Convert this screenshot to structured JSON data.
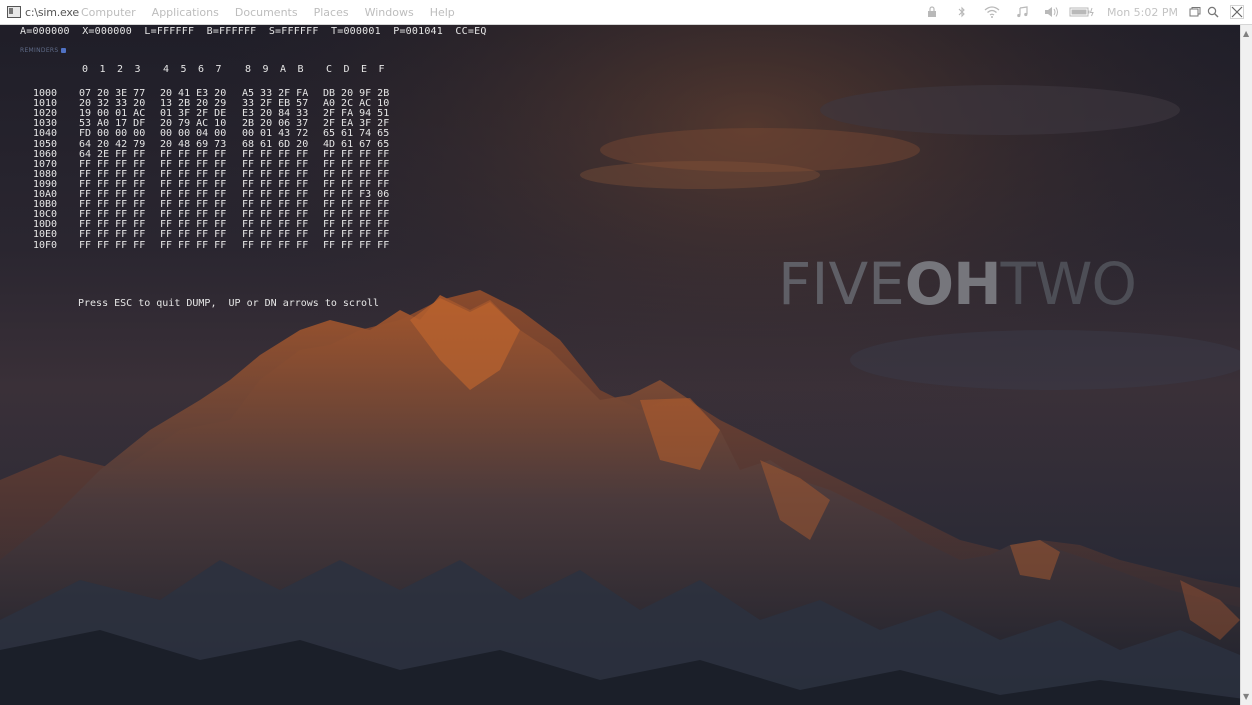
{
  "window": {
    "title": "c:\\sim.exe",
    "app_icon": "console-window-icon"
  },
  "menubar": {
    "items": [
      "Computer",
      "Applications",
      "Documents",
      "Places",
      "Windows",
      "Help"
    ],
    "clock": "Mon 5:02 PM",
    "tray_icons": [
      "lock-icon",
      "bluetooth-icon",
      "wifi-icon",
      "music-icon",
      "volume-icon",
      "battery-icon"
    ],
    "window_buttons": [
      "restore-icon",
      "search-icon",
      "close-icon"
    ]
  },
  "registers": "A=000000  X=000000  L=FFFFFF  B=FFFFFF  S=FFFFFF  T=000001  P=001041  CC=EQ",
  "reminders_label": "REMINDERS",
  "dump": {
    "header": [
      "0",
      "1",
      "2",
      "3",
      "4",
      "5",
      "6",
      "7",
      "8",
      "9",
      "A",
      "B",
      "C",
      "D",
      "E",
      "F"
    ],
    "rows": [
      {
        "addr": "1000",
        "bytes": [
          "07",
          "20",
          "3E",
          "77",
          "20",
          "41",
          "E3",
          "20",
          "A5",
          "33",
          "2F",
          "FA",
          "DB",
          "20",
          "9F",
          "2B"
        ]
      },
      {
        "addr": "1010",
        "bytes": [
          "20",
          "32",
          "33",
          "20",
          "13",
          "2B",
          "20",
          "29",
          "33",
          "2F",
          "EB",
          "57",
          "A0",
          "2C",
          "AC",
          "10"
        ]
      },
      {
        "addr": "1020",
        "bytes": [
          "19",
          "00",
          "01",
          "AC",
          "01",
          "3F",
          "2F",
          "DE",
          "E3",
          "20",
          "84",
          "33",
          "2F",
          "FA",
          "94",
          "51"
        ]
      },
      {
        "addr": "1030",
        "bytes": [
          "53",
          "A0",
          "17",
          "DF",
          "20",
          "79",
          "AC",
          "10",
          "2B",
          "20",
          "06",
          "37",
          "2F",
          "EA",
          "3F",
          "2F"
        ]
      },
      {
        "addr": "1040",
        "bytes": [
          "FD",
          "00",
          "00",
          "00",
          "00",
          "00",
          "04",
          "00",
          "00",
          "01",
          "43",
          "72",
          "65",
          "61",
          "74",
          "65"
        ]
      },
      {
        "addr": "1050",
        "bytes": [
          "64",
          "20",
          "42",
          "79",
          "20",
          "48",
          "69",
          "73",
          "68",
          "61",
          "6D",
          "20",
          "4D",
          "61",
          "67",
          "65"
        ]
      },
      {
        "addr": "1060",
        "bytes": [
          "64",
          "2E",
          "FF",
          "FF",
          "FF",
          "FF",
          "FF",
          "FF",
          "FF",
          "FF",
          "FF",
          "FF",
          "FF",
          "FF",
          "FF",
          "FF"
        ]
      },
      {
        "addr": "1070",
        "bytes": [
          "FF",
          "FF",
          "FF",
          "FF",
          "FF",
          "FF",
          "FF",
          "FF",
          "FF",
          "FF",
          "FF",
          "FF",
          "FF",
          "FF",
          "FF",
          "FF"
        ]
      },
      {
        "addr": "1080",
        "bytes": [
          "FF",
          "FF",
          "FF",
          "FF",
          "FF",
          "FF",
          "FF",
          "FF",
          "FF",
          "FF",
          "FF",
          "FF",
          "FF",
          "FF",
          "FF",
          "FF"
        ]
      },
      {
        "addr": "1090",
        "bytes": [
          "FF",
          "FF",
          "FF",
          "FF",
          "FF",
          "FF",
          "FF",
          "FF",
          "FF",
          "FF",
          "FF",
          "FF",
          "FF",
          "FF",
          "FF",
          "FF"
        ]
      },
      {
        "addr": "10A0",
        "bytes": [
          "FF",
          "FF",
          "FF",
          "FF",
          "FF",
          "FF",
          "FF",
          "FF",
          "FF",
          "FF",
          "FF",
          "FF",
          "FF",
          "FF",
          "F3",
          "06"
        ]
      },
      {
        "addr": "10B0",
        "bytes": [
          "FF",
          "FF",
          "FF",
          "FF",
          "FF",
          "FF",
          "FF",
          "FF",
          "FF",
          "FF",
          "FF",
          "FF",
          "FF",
          "FF",
          "FF",
          "FF"
        ]
      },
      {
        "addr": "10C0",
        "bytes": [
          "FF",
          "FF",
          "FF",
          "FF",
          "FF",
          "FF",
          "FF",
          "FF",
          "FF",
          "FF",
          "FF",
          "FF",
          "FF",
          "FF",
          "FF",
          "FF"
        ]
      },
      {
        "addr": "10D0",
        "bytes": [
          "FF",
          "FF",
          "FF",
          "FF",
          "FF",
          "FF",
          "FF",
          "FF",
          "FF",
          "FF",
          "FF",
          "FF",
          "FF",
          "FF",
          "FF",
          "FF"
        ]
      },
      {
        "addr": "10E0",
        "bytes": [
          "FF",
          "FF",
          "FF",
          "FF",
          "FF",
          "FF",
          "FF",
          "FF",
          "FF",
          "FF",
          "FF",
          "FF",
          "FF",
          "FF",
          "FF",
          "FF"
        ]
      },
      {
        "addr": "10F0",
        "bytes": [
          "FF",
          "FF",
          "FF",
          "FF",
          "FF",
          "FF",
          "FF",
          "FF",
          "FF",
          "FF",
          "FF",
          "FF",
          "FF",
          "FF",
          "FF",
          "FF"
        ]
      }
    ],
    "footer": "Press ESC to quit DUMP,  UP or DN arrows to scroll"
  },
  "wallpaper_logo": {
    "part1": "FIVE",
    "part2": "OH",
    "part3": "TWO"
  },
  "colors": {
    "console_text": "#e6e6e6",
    "menubar_bg": "#ffffff",
    "reminder_blue": "#5072c4"
  }
}
